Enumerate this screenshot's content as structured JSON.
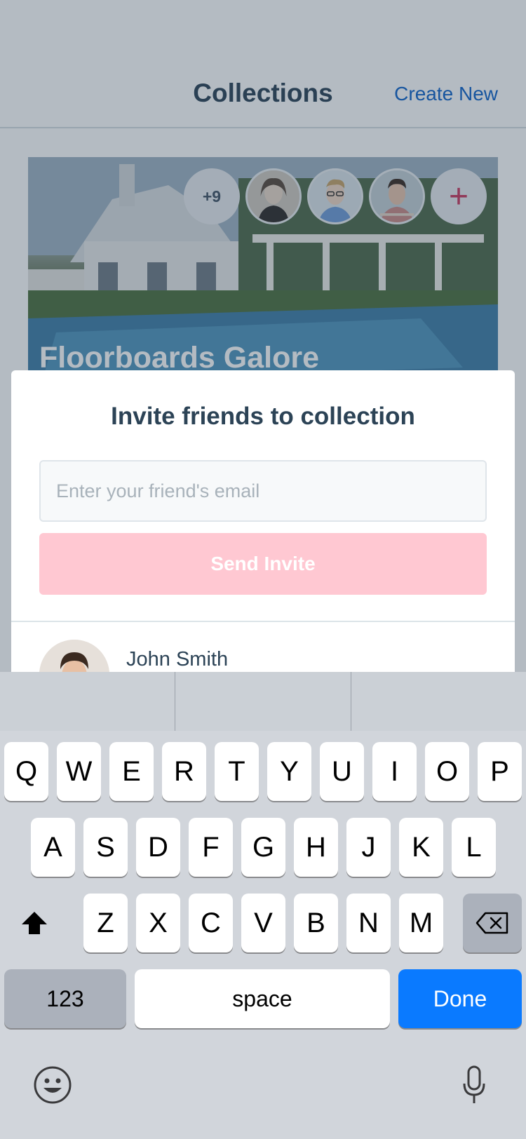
{
  "nav": {
    "title": "Collections",
    "create_new": "Create New"
  },
  "collection": {
    "title": "Floorboards Galore",
    "member_overflow": "+9",
    "add_symbol": "+"
  },
  "invite": {
    "title": "Invite friends to collection",
    "email_placeholder": "Enter your friend's email",
    "email_value": "",
    "send_label": "Send Invite"
  },
  "friends": [
    {
      "name": "John Smith"
    }
  ],
  "keyboard": {
    "row1": [
      "Q",
      "W",
      "E",
      "R",
      "T",
      "Y",
      "U",
      "I",
      "O",
      "P"
    ],
    "row2": [
      "A",
      "S",
      "D",
      "F",
      "G",
      "H",
      "J",
      "K",
      "L"
    ],
    "row3": [
      "Z",
      "X",
      "C",
      "V",
      "B",
      "N",
      "M"
    ],
    "numbers_label": "123",
    "space_label": "space",
    "done_label": "Done"
  },
  "colors": {
    "accent": "#0e63c9",
    "brand_pink": "#c9385f",
    "button_disabled": "#ffc8d2",
    "done_blue": "#0a7aff"
  }
}
